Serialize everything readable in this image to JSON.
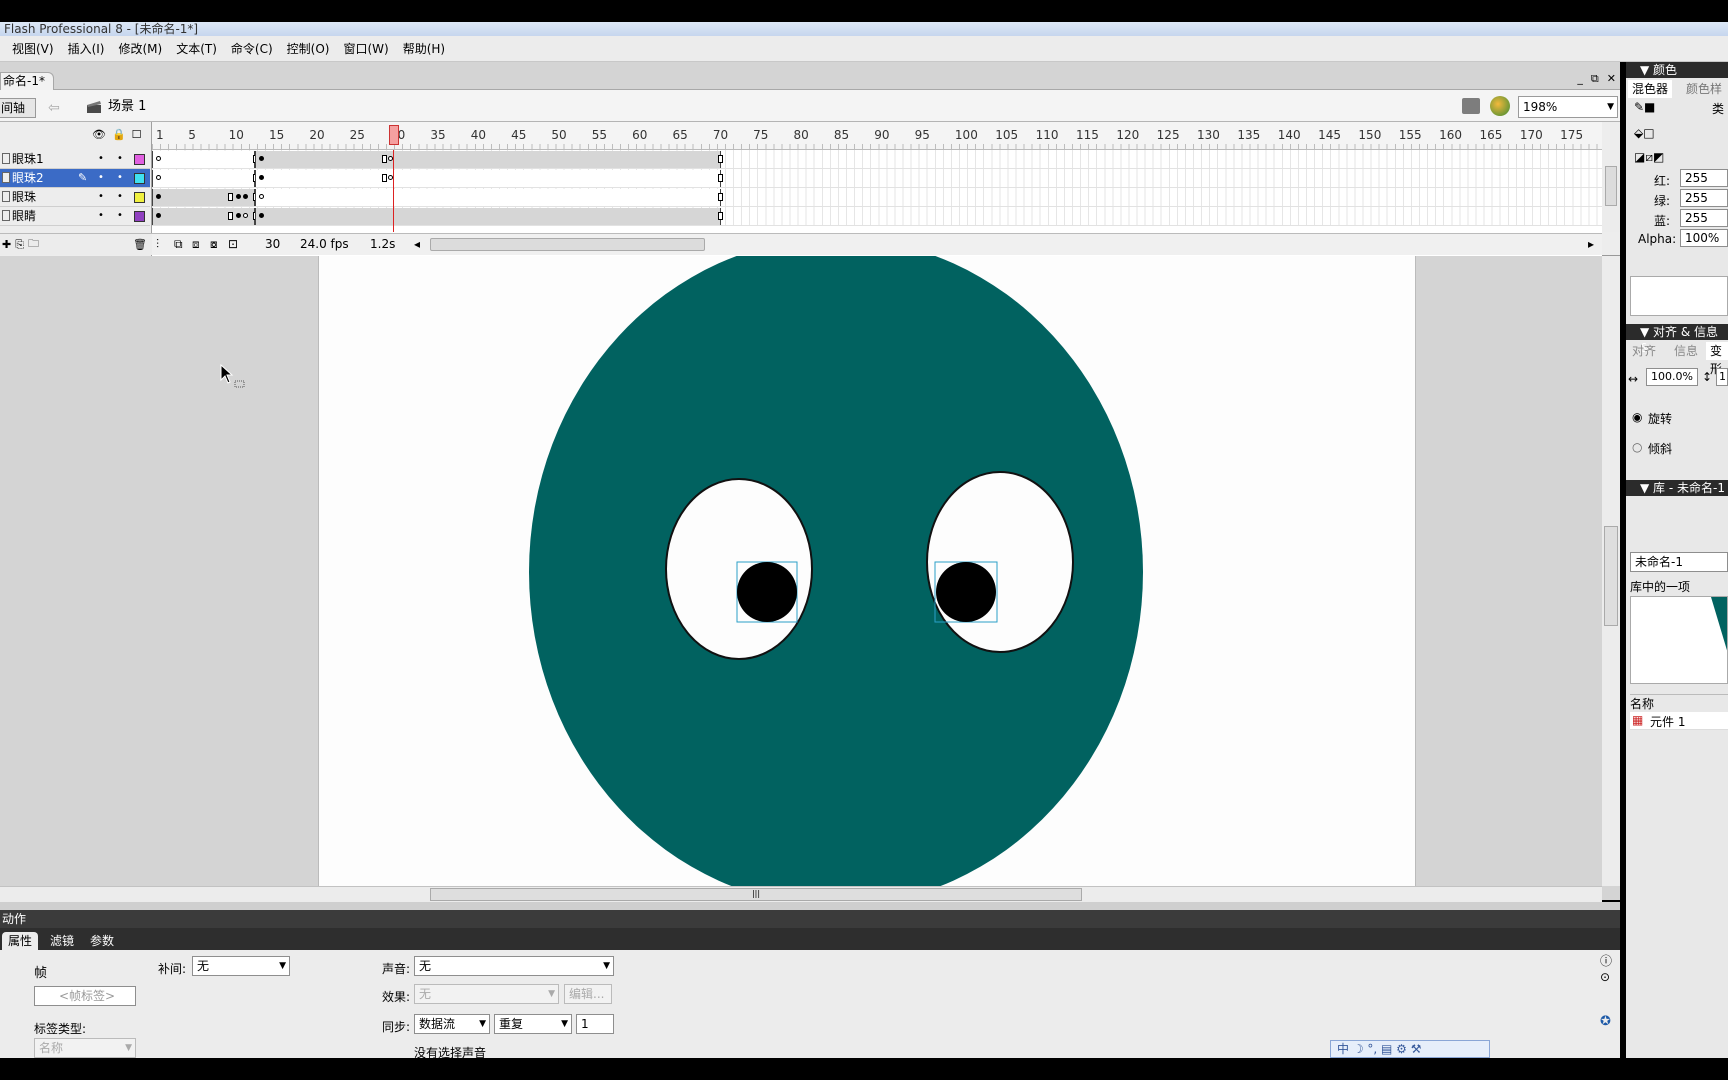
{
  "window": {
    "title": "Flash Professional 8 - [未命名-1*]"
  },
  "menu": [
    "视图(V)",
    "插入(I)",
    "修改(M)",
    "文本(T)",
    "命令(C)",
    "控制(O)",
    "窗口(W)",
    "帮助(H)"
  ],
  "document": {
    "tab": "命名-1*",
    "timeline_button": "间轴",
    "scene": "场景 1",
    "zoom": "198%",
    "window_controls": [
      "_",
      "⧉",
      "✕"
    ]
  },
  "timeline": {
    "ruler_labels": [
      "1",
      "5",
      "10",
      "15",
      "20",
      "25",
      "30",
      "35",
      "40",
      "45",
      "50",
      "55",
      "60",
      "65",
      "70",
      "75",
      "80",
      "85",
      "90",
      "95",
      "100",
      "105",
      "110",
      "115",
      "120",
      "125",
      "130",
      "135",
      "140",
      "145",
      "150",
      "155",
      "160",
      "165",
      "170",
      "175"
    ],
    "layers": [
      {
        "name": "眼珠1",
        "color": "#e060e0",
        "selected": false
      },
      {
        "name": "眼珠2",
        "color": "#40e0f0",
        "selected": true
      },
      {
        "name": "眼珠",
        "color": "#f0f040",
        "selected": false
      },
      {
        "name": "眼睛",
        "color": "#9040c0",
        "selected": false
      }
    ],
    "current_frame": "30",
    "fps": "24.0 fps",
    "elapsed": "1.2s"
  },
  "stage": {
    "face_color": "#016260",
    "eye_white": "#fdfdfd",
    "pupil_color": "#000000"
  },
  "panels": {
    "actions_label": "动作",
    "tabs": [
      "属性",
      "滤镜",
      "参数"
    ],
    "frame_label": "帧",
    "frame_name_placeholder": "<帧标签>",
    "label_type": "标签类型:",
    "label_type_value": "名称",
    "tween_label": "补间:",
    "tween_value": "无",
    "sound_label": "声音:",
    "sound_value": "无",
    "effect_label": "效果:",
    "effect_value": "无",
    "edit_button": "编辑...",
    "sync_label": "同步:",
    "sync_value": "数据流",
    "repeat_value": "重复",
    "repeat_count": "1",
    "no_sound": "没有选择声音"
  },
  "ime": "中 ☽ °, ▤ ⚙ ⚒",
  "right_panel": {
    "color_title": "▼ 颜色",
    "mixer_tab": "混色器",
    "swatches_tab": "颜色样",
    "type_label": "类",
    "red_label": "红:",
    "red": "255",
    "green_label": "绿:",
    "green": "255",
    "blue_label": "蓝:",
    "blue": "255",
    "alpha_label": "Alpha:",
    "alpha": "100%",
    "align_title": "▼ 对齐 & 信息 &",
    "align_tab": "对齐",
    "info_tab": "信息",
    "transform_tab": "变形",
    "scale": "100.0%",
    "scale2": "1",
    "rotate": "旋转",
    "skew": "倾斜",
    "library_title": "▼ 库 - 未命名-1",
    "library_doc": "未命名-1",
    "library_count": "库中的一项",
    "name_col": "名称",
    "item": "元件 1"
  }
}
